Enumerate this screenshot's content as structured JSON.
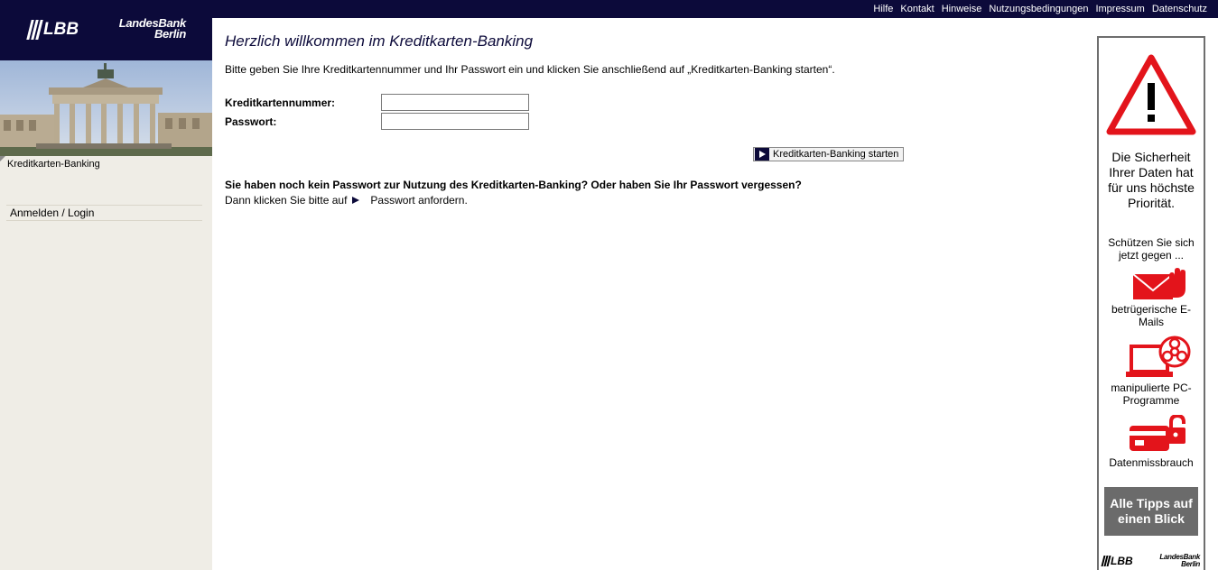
{
  "topnav": {
    "links": [
      "Hilfe",
      "Kontakt",
      "Hinweise",
      "Nutzungsbedingungen",
      "Impressum",
      "Datenschutz"
    ]
  },
  "brand": {
    "short": "LBB",
    "name_line1": "LandesBank",
    "name_line2": "Berlin"
  },
  "sidebar": {
    "section_label": "Kreditkarten-Banking",
    "login_label": "Anmelden / Login"
  },
  "main": {
    "title": "Herzlich willkommen im Kreditkarten-Banking",
    "intro": "Bitte geben Sie Ihre Kreditkartennummer und Ihr Passwort ein und klicken Sie anschließend auf „Kreditkarten-Banking starten“.",
    "card_label": "Kreditkartennummer:",
    "card_value": "",
    "password_label": "Passwort:",
    "password_value": "",
    "start_button": "Kreditkarten-Banking starten",
    "question": "Sie haben noch kein Passwort zur Nutzung des Kreditkarten-Banking? Oder haben Sie Ihr Passwort vergessen?",
    "hint_prefix": "Dann klicken Sie bitte auf",
    "hint_link": "Passwort anfordern."
  },
  "security": {
    "headline": "Die Sicherheit Ihrer Daten hat für uns höchste Priorität.",
    "sub": "Schützen Sie sich jetzt gegen ...",
    "items": [
      {
        "icon": "email-stop-icon",
        "caption": "betrügerische E-Mails"
      },
      {
        "icon": "laptop-biohazard-icon",
        "caption": "manipulierte PC-Programme"
      },
      {
        "icon": "card-lock-icon",
        "caption": "Datenmissbrauch"
      }
    ],
    "button": "Alle Tipps auf einen Blick",
    "footer_short": "LBB",
    "footer_name1": "LandesBank",
    "footer_name2": "Berlin"
  },
  "colors": {
    "navy": "#0c0a3a",
    "sidebar_bg": "#efede6",
    "warning_red": "#e3141b",
    "button_gray": "#6b6b6b"
  }
}
